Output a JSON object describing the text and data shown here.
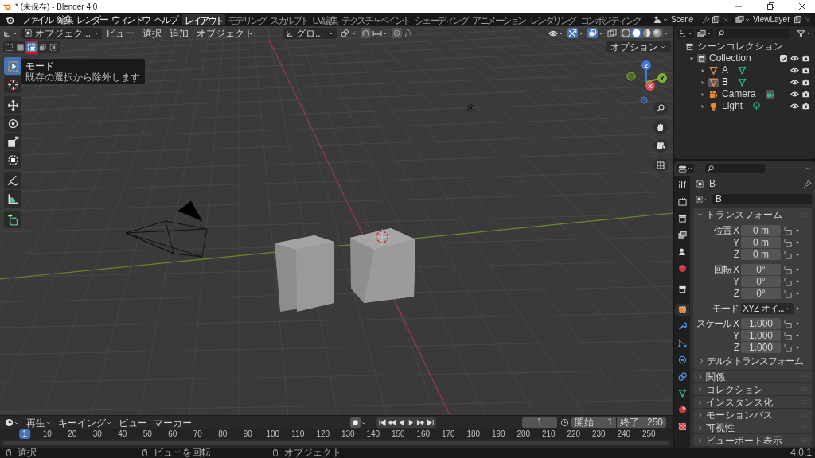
{
  "window": {
    "title": "* (未保存) - Blender 4.0"
  },
  "menu": [
    "ファイル",
    "編集",
    "レンダー",
    "ウィンドウ",
    "ヘルプ"
  ],
  "workspaces": [
    {
      "label": "レイアウト",
      "selected": true
    },
    {
      "label": "モデリング",
      "selected": false
    },
    {
      "label": "スカルプト",
      "selected": false
    },
    {
      "label": "UV編集",
      "selected": false
    },
    {
      "label": "テクスチャペイント",
      "selected": false
    },
    {
      "label": "シェーディング",
      "selected": false
    },
    {
      "label": "アニメーション",
      "selected": false
    },
    {
      "label": "レンダリング",
      "selected": false
    },
    {
      "label": "コンポジティング",
      "selected": false
    }
  ],
  "scene": "Scene",
  "view_layer": "ViewLayer",
  "viewport": {
    "mode": "オブジェク...",
    "menus": [
      "ビュー",
      "選択",
      "追加",
      "オブジェクト"
    ],
    "orientation": "グロ...",
    "options": "オプション",
    "select_modes": [
      {
        "selected": false
      },
      {
        "selected": false
      },
      {
        "selected": true
      },
      {
        "selected": false
      },
      {
        "selected": false
      }
    ],
    "gizmo_on": true,
    "overlays_on": true,
    "shading": [
      {
        "selected": false
      },
      {
        "selected": true
      },
      {
        "selected": false
      },
      {
        "selected": false
      }
    ],
    "tools": [
      {
        "kind": "select",
        "selected": true
      },
      {
        "kind": "cursor",
        "selected": false
      },
      {
        "kind": "move",
        "selected": false
      },
      {
        "kind": "rotate",
        "selected": false
      },
      {
        "kind": "scale",
        "selected": false
      },
      {
        "kind": "transform",
        "selected": false
      },
      {
        "kind": "annotate",
        "selected": false
      },
      {
        "kind": "measure",
        "selected": false
      },
      {
        "kind": "add-cube",
        "selected": false
      }
    ],
    "tooltip": {
      "title": "モード",
      "text": "既存の選択から除外します"
    },
    "gizmo_axes": [
      "X",
      "Y",
      "Z"
    ]
  },
  "outliner": {
    "root": "シーンコレクション",
    "collection": {
      "label": "Collection",
      "expanded": true,
      "checked": true,
      "children": [
        {
          "label": "A",
          "kind": "mesh",
          "selected": false
        },
        {
          "label": "B",
          "kind": "mesh",
          "selected": true
        },
        {
          "label": "Camera",
          "kind": "camera",
          "selected": false
        },
        {
          "label": "Light",
          "kind": "light",
          "selected": false
        }
      ]
    }
  },
  "properties": {
    "tabs": [
      {
        "kind": "tool",
        "selected": false
      },
      {
        "kind": "render",
        "selected": false
      },
      {
        "kind": "output",
        "selected": false
      },
      {
        "kind": "view-layer",
        "selected": false
      },
      {
        "kind": "scene",
        "selected": false
      },
      {
        "kind": "world",
        "selected": false
      },
      {
        "kind": "collection",
        "selected": false
      },
      {
        "kind": "object",
        "selected": true
      },
      {
        "kind": "modifier",
        "selected": false
      },
      {
        "kind": "particles",
        "selected": false
      },
      {
        "kind": "physics",
        "selected": false
      },
      {
        "kind": "constraints",
        "selected": false
      },
      {
        "kind": "data",
        "selected": false
      },
      {
        "kind": "material",
        "selected": false
      },
      {
        "kind": "texture",
        "selected": false
      }
    ],
    "object": "B",
    "name": "B",
    "transform": {
      "title": "トランスフォーム",
      "expanded": true,
      "rows": [
        {
          "kind": "number",
          "label": "位置 X",
          "value": "0 m"
        },
        {
          "kind": "number",
          "label": "Y",
          "value": "0 m"
        },
        {
          "kind": "number",
          "label": "Z",
          "value": "0 m"
        },
        {
          "kind": "number",
          "label": "回転 X",
          "value": "0°"
        },
        {
          "kind": "number",
          "label": "Y",
          "value": "0°"
        },
        {
          "kind": "number",
          "label": "Z",
          "value": "0°"
        },
        {
          "kind": "dropdown",
          "label": "モード",
          "value": "XYZ オイ..."
        },
        {
          "kind": "number",
          "label": "スケール X",
          "value": "1.000"
        },
        {
          "kind": "number",
          "label": "Y",
          "value": "1.000"
        },
        {
          "kind": "number",
          "label": "Z",
          "value": "1.000"
        }
      ],
      "subpanel": "デルタトランスフォーム"
    },
    "panels": [
      "関係",
      "コレクション",
      "インスタンス化",
      "モーションパス",
      "可視性",
      "ビューポート表示"
    ]
  },
  "timeline": {
    "menus": [
      "再生",
      "キーイング",
      "ビュー",
      "マーカー"
    ],
    "current_frame": "1",
    "start_label": "開始",
    "start": "1",
    "end_label": "終了",
    "end": "250",
    "ruler": [
      "1",
      "10",
      "20",
      "30",
      "40",
      "50",
      "60",
      "70",
      "80",
      "90",
      "100",
      "110",
      "120",
      "130",
      "140",
      "150",
      "160",
      "170",
      "180",
      "190",
      "200",
      "210",
      "220",
      "230",
      "240",
      "250"
    ]
  },
  "status_bar": {
    "hints": [
      "選択",
      "ビューを回転",
      "オブジェクト"
    ],
    "version": "4.0.1"
  }
}
